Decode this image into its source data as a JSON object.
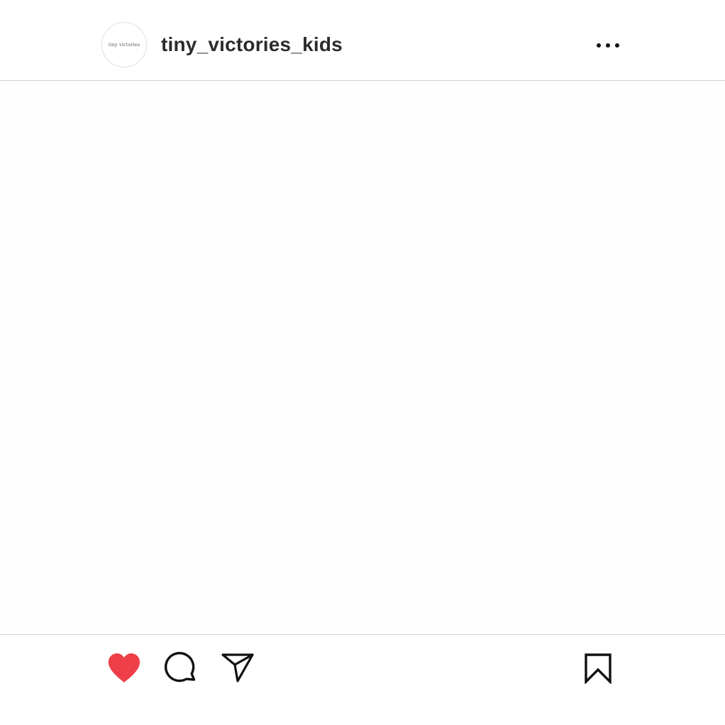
{
  "post": {
    "author": {
      "username": "tiny_victories_kids",
      "avatar_text": "tiny victories"
    },
    "liked": true,
    "colors": {
      "like_active": "#ee3e48",
      "icon": "#111111",
      "divider": "#d6d6d6"
    },
    "icons": {
      "more": "more-horizontal-icon",
      "like": "heart-filled-icon",
      "comment": "comment-bubble-icon",
      "share": "paper-plane-icon",
      "save": "bookmark-icon"
    }
  }
}
